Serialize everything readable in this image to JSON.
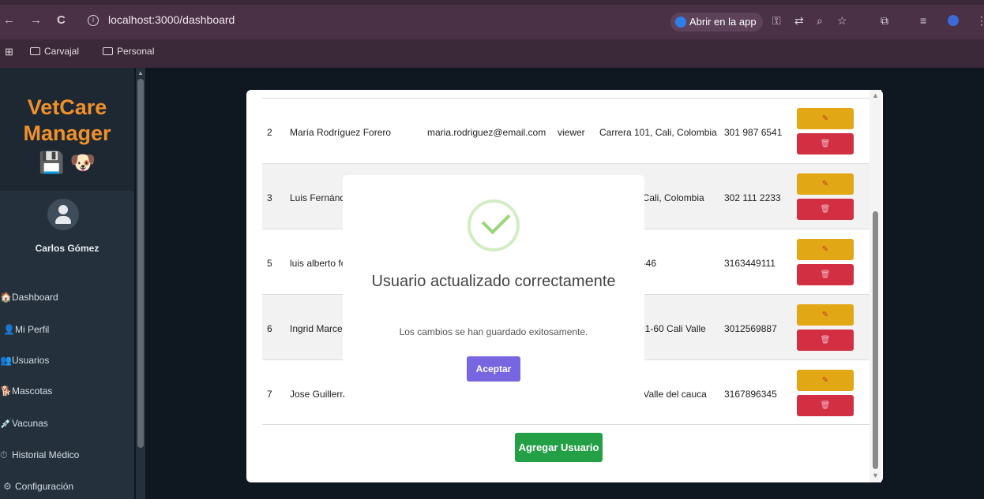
{
  "browser": {
    "back": "←",
    "forward": "→",
    "reload": "C",
    "url": "localhost:3000/dashboard",
    "open_app": "Abrir en la app",
    "bookmarks": [
      "Carvajal",
      "Personal"
    ]
  },
  "sidebar": {
    "brand_line1": "VetCare",
    "brand_line2": "Manager",
    "brand_icons": "💾 🐶",
    "username": "Carlos Gómez",
    "items": [
      {
        "icon": "🏠",
        "label": "Dashboard"
      },
      {
        "icon": "👤",
        "label": "Mi Perfil"
      },
      {
        "icon": "👥",
        "label": "Usuarios"
      },
      {
        "icon": "🐕",
        "label": "Mascotas"
      },
      {
        "icon": "💉",
        "label": "Vacunas"
      },
      {
        "icon": "⏱",
        "label": "Historial Médico"
      },
      {
        "icon": "⚙",
        "label": "Configuración"
      }
    ]
  },
  "table": {
    "rows": [
      {
        "id": "2",
        "name": "María Rodríguez Forero",
        "email": "maria.rodriguez@email.com",
        "role": "viewer",
        "address": "Carrera 101, Cali, Colombia",
        "phone": "301 987 6541"
      },
      {
        "id": "3",
        "name": "Luis Fernánd",
        "email": "",
        "role": "",
        "address": ", Cali, Colombia",
        "phone": "302 111 2233"
      },
      {
        "id": "5",
        "name": "luis alberto fo",
        "email": "",
        "role": "",
        "address": "a-46",
        "phone": "3163449111"
      },
      {
        "id": "6",
        "name": "Ingrid Marce",
        "email": "",
        "role": "",
        "address": "01-60 Cali Valle",
        "phone": "3012569887"
      },
      {
        "id": "7",
        "name": "Jose Guillerm",
        "email": "",
        "role": "",
        "address": "- Valle del cauca",
        "phone": "3167896345"
      }
    ],
    "edit_icon": "✎",
    "delete_icon": "🗑",
    "add_button": "Agregar Usuario"
  },
  "modal": {
    "title": "Usuario actualizado correctamente",
    "message": "Los cambios se han guardado exitosamente.",
    "ok_button": "Aceptar"
  },
  "colors": {
    "brand": "#f0902c",
    "edit": "#e2a714",
    "delete": "#d22f43",
    "add": "#23a046",
    "ok": "#7766e0"
  }
}
